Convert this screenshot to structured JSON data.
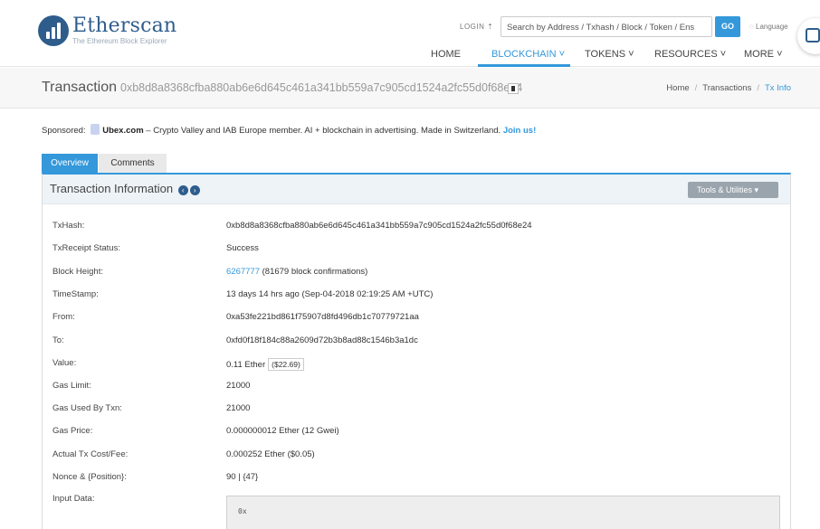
{
  "header": {
    "logo": {
      "name": "Etherscan",
      "tagline": "The Ethereum Block Explorer"
    },
    "login": "LOGIN",
    "search_placeholder": "Search by Address / Txhash / Block / Token / Ens",
    "go_label": "GO",
    "language": "Language",
    "nav": [
      {
        "label": "HOME",
        "active": false
      },
      {
        "label": "BLOCKCHAIN",
        "active": true
      },
      {
        "label": "TOKENS",
        "active": false
      },
      {
        "label": "RESOURCES",
        "active": false
      },
      {
        "label": "MORE",
        "active": false
      }
    ]
  },
  "titlebar": {
    "title": "Transaction",
    "hash": "0xb8d8a8368cfba880ab6e6d645c461a341bb559a7c905cd1524a2fc55d0f68e24",
    "breadcrumb": [
      "Home",
      "Transactions",
      "Tx Info"
    ]
  },
  "sponsored": {
    "prefix": "Sponsored:",
    "brand": "Ubex.com",
    "text": " – Crypto Valley and IAB Europe member. AI + blockchain in advertising. Made in Switzerland.",
    "cta": "Join us!"
  },
  "tabs": [
    "Overview",
    "Comments"
  ],
  "panel": {
    "title": "Transaction Information",
    "tools_label": "Tools & Utilities"
  },
  "fields": {
    "txhash": {
      "label": "TxHash:",
      "value": "0xb8d8a8368cfba880ab6e6d645c461a341bb559a7c905cd1524a2fc55d0f68e24"
    },
    "status": {
      "label": "TxReceipt Status:",
      "value": "Success"
    },
    "block": {
      "label": "Block Height:",
      "value": "6267777",
      "confirmations": "(81679 block confirmations)"
    },
    "timestamp": {
      "label": "TimeStamp:",
      "value": "13 days 14 hrs ago (Sep-04-2018 02:19:25 AM +UTC)"
    },
    "from": {
      "label": "From:",
      "value": "0xa53fe221bd861f75907d8fd496db1c70779721aa"
    },
    "to": {
      "label": "To:",
      "value": "0xfd0f18f184c88a2609d72b3b8ad88c1546b3a1dc"
    },
    "value": {
      "label": "Value:",
      "value": "0.11 Ether",
      "usd": "($22.69)"
    },
    "gas_limit": {
      "label": "Gas Limit:",
      "value": "21000"
    },
    "gas_used": {
      "label": "Gas Used By Txn:",
      "value": "21000"
    },
    "gas_price": {
      "label": "Gas Price:",
      "value": "0.000000012 Ether (12 Gwei)"
    },
    "fee": {
      "label": "Actual Tx Cost/Fee:",
      "value": "0.000252 Ether ($0.05)"
    },
    "nonce": {
      "label": "Nonce & {Position}:",
      "value": "90 | {47}"
    },
    "input": {
      "label": "Input Data:",
      "value": "0x"
    }
  }
}
